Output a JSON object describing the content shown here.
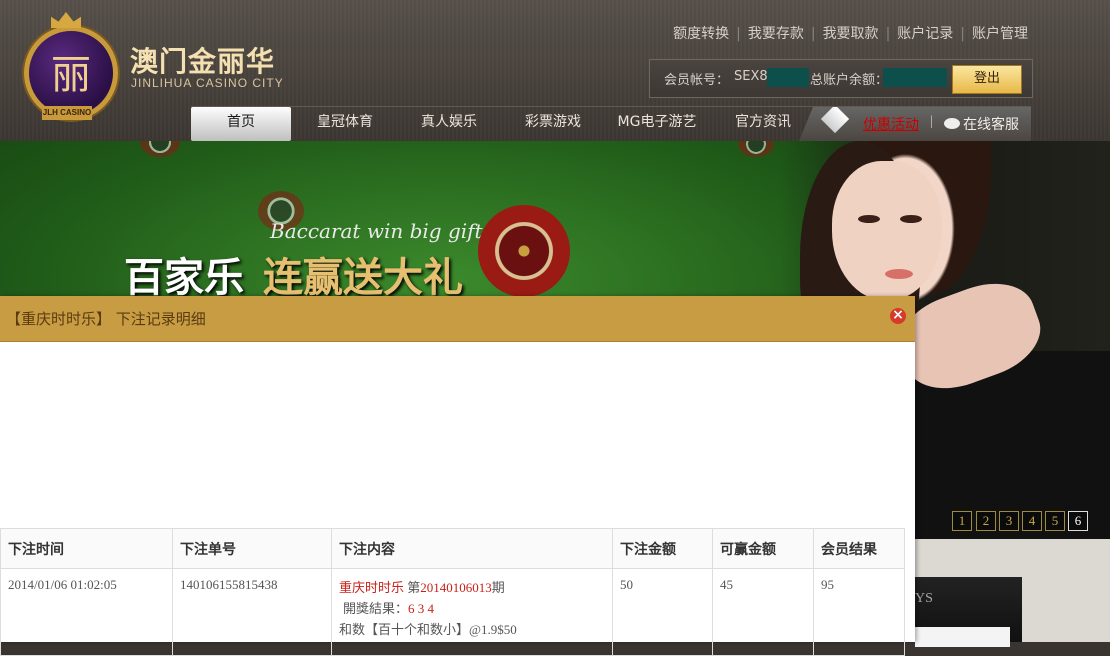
{
  "brand": {
    "logo_glyph": "丽",
    "logo_ribbon": "JLH CASINO",
    "name_cn": "澳门金丽华",
    "name_en": "JINLIHUA CASINO CITY"
  },
  "top_links": [
    "额度转换",
    "我要存款",
    "我要取款",
    "账户记录",
    "账户管理"
  ],
  "account": {
    "account_label": "会员帐号：",
    "account_value": "SEX8",
    "balance_label": "总账户余额：",
    "logout_label": "登出"
  },
  "nav": {
    "items": [
      "首页",
      "皇冠体育",
      "真人娱乐",
      "彩票游戏",
      "MG电子游艺",
      "官方资讯"
    ],
    "promo": "优惠活动",
    "separator": "|",
    "service": "在线客服"
  },
  "banner": {
    "title_en": "Baccarat win big gifts",
    "title_cn_part1": "百家乐",
    "title_cn_part2": "连赢送大礼",
    "slides": [
      "1",
      "2",
      "3",
      "4",
      "5",
      "6"
    ],
    "active_slide": "6"
  },
  "side_panel": {
    "text": "YS"
  },
  "modal": {
    "title": "【重庆时时乐】 下注记录明细",
    "close_icon": "×",
    "table": {
      "headers": [
        "下注时间",
        "下注单号",
        "下注内容",
        "下注金额",
        "可赢金额",
        "会员结果"
      ],
      "rows": [
        {
          "time": "2014/01/06 01:02:05",
          "order_no": "140106155815438",
          "game": "重庆时时乐",
          "period_prefix": "第",
          "period_no": "20140106013",
          "period_suffix": "期",
          "result_label": "開獎結果：",
          "result_value": "6 3 4",
          "bet_detail": "和数【百十个和数小】@1.9$50",
          "amount": "50",
          "win_amount": "45",
          "member_result": "95"
        }
      ]
    }
  },
  "colors": {
    "modal_header": "#c89c42",
    "accent_red": "#c8221a",
    "logout_gold": "#e8b848",
    "mask_teal": "#0d4f4a"
  }
}
